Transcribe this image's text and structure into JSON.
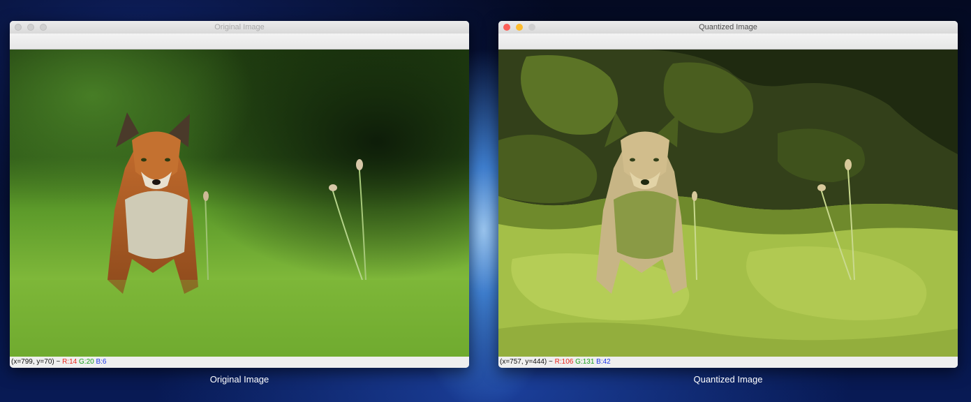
{
  "windows": [
    {
      "title": "Original Image",
      "caption": "Original Image",
      "status": {
        "coords": "(x=799, y=70) ~",
        "r": "R:14",
        "g": "G:20",
        "b": "B:6"
      }
    },
    {
      "title": "Quantized Image",
      "caption": "Quantized Image",
      "status": {
        "coords": "(x=757, y=444) ~",
        "r": "R:106",
        "g": "G:131",
        "b": "B:42"
      }
    }
  ],
  "colors": {
    "traffic_close": "#fc5f57",
    "traffic_minimize": "#fdbc2e",
    "status_red": "#e8261c",
    "status_green": "#18a01c",
    "status_blue": "#1b35e6"
  }
}
